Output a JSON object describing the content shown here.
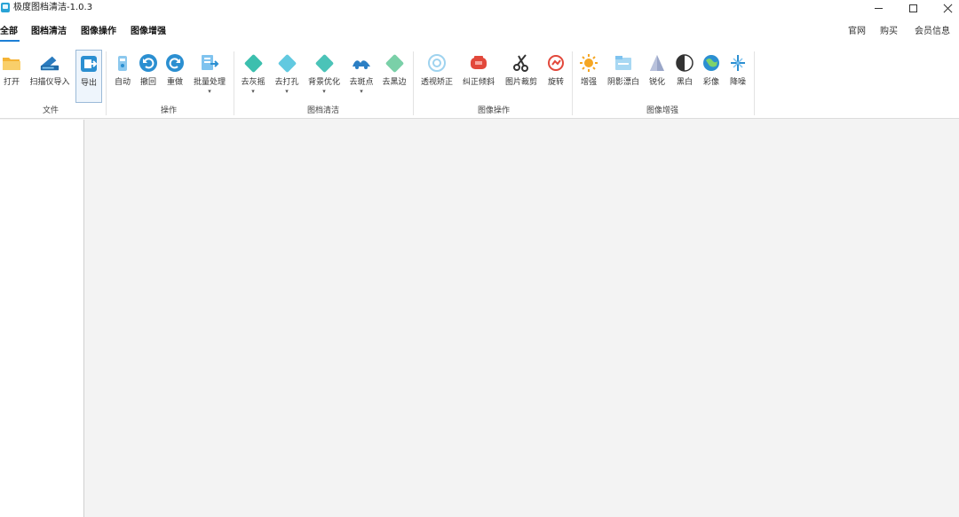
{
  "window": {
    "title": "极度图档清洁-1.0.3"
  },
  "tabs": {
    "items": [
      {
        "label": "全部"
      },
      {
        "label": "图档清洁"
      },
      {
        "label": "图像操作"
      },
      {
        "label": "图像增强"
      }
    ]
  },
  "header_links": {
    "items": [
      {
        "label": "官网"
      },
      {
        "label": "购买"
      },
      {
        "label": "会员信息"
      }
    ]
  },
  "ribbon": {
    "groups": [
      {
        "label": "文件",
        "tools": [
          {
            "label": "打开",
            "icon": "open-folder-icon"
          },
          {
            "label": "扫描仪导入",
            "icon": "scanner-icon"
          },
          {
            "label": "导出",
            "icon": "export-icon"
          }
        ]
      },
      {
        "label": "操作",
        "tools": [
          {
            "label": "自动",
            "icon": "auto-icon"
          },
          {
            "label": "撤回",
            "icon": "undo-icon"
          },
          {
            "label": "重做",
            "icon": "redo-icon"
          },
          {
            "label": "批量处理",
            "icon": "batch-icon"
          }
        ]
      },
      {
        "label": "图档清洁",
        "tools": [
          {
            "label": "去灰摇",
            "icon": "clean-diamond-icon"
          },
          {
            "label": "去打孔",
            "icon": "punch-hole-icon"
          },
          {
            "label": "背景优化",
            "icon": "background-optimize-icon"
          },
          {
            "label": "去斑点",
            "icon": "despeckle-icon"
          },
          {
            "label": "去黑边",
            "icon": "black-border-icon"
          }
        ]
      },
      {
        "label": "图像操作",
        "tools": [
          {
            "label": "透视矫正",
            "icon": "perspective-icon"
          },
          {
            "label": "纠正倾斜",
            "icon": "deskew-icon"
          },
          {
            "label": "图片裁剪",
            "icon": "scissors-icon"
          },
          {
            "label": "旋转",
            "icon": "rotate-icon"
          }
        ]
      },
      {
        "label": "图像增强",
        "tools": [
          {
            "label": "增强",
            "icon": "sun-icon"
          },
          {
            "label": "阴影漂白",
            "icon": "shadow-bleach-icon"
          },
          {
            "label": "锐化",
            "icon": "sharpen-icon"
          },
          {
            "label": "黑白",
            "icon": "black-white-icon"
          },
          {
            "label": "彩像",
            "icon": "color-icon"
          },
          {
            "label": "降噪",
            "icon": "denoise-icon"
          }
        ]
      }
    ]
  },
  "colors": {
    "accent": "#1d7fd6",
    "icon_blue": "#2b8fd1",
    "icon_teal": "#3cbfae",
    "icon_red": "#e2483b",
    "icon_orange": "#f5a623"
  }
}
